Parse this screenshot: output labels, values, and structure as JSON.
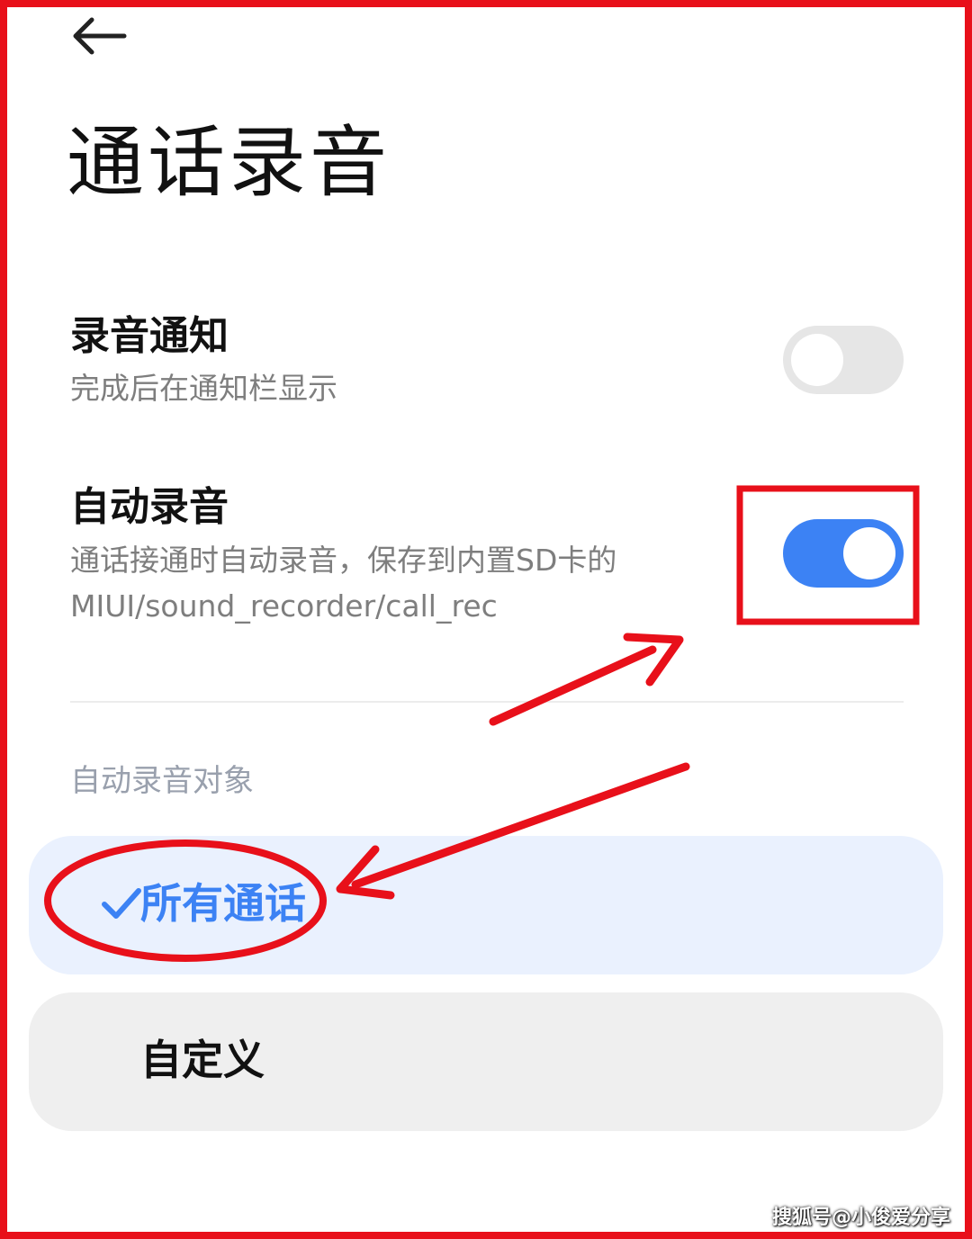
{
  "header": {
    "back_icon": "arrow-left-icon",
    "title": "通话录音"
  },
  "settings": [
    {
      "title": "录音通知",
      "subtitle": "完成后在通知栏显示",
      "enabled": false
    },
    {
      "title": "自动录音",
      "subtitle_line1": "通话接通时自动录音，保存到内置SD卡的",
      "subtitle_line2": "MIUI/sound_recorder/call_rec",
      "enabled": true
    }
  ],
  "section": {
    "label": "自动录音对象",
    "options": [
      {
        "label": "所有通话",
        "selected": true,
        "icon": "checkmark-icon"
      },
      {
        "label": "自定义",
        "selected": false
      }
    ]
  },
  "watermark": "搜狐号@小俊爱分享",
  "colors": {
    "accent": "#3c82f4",
    "annotation_red": "#e8101a",
    "selected_bg": "#eaf1fe",
    "option_bg": "#efefef",
    "switch_off": "#e6e6e6"
  }
}
